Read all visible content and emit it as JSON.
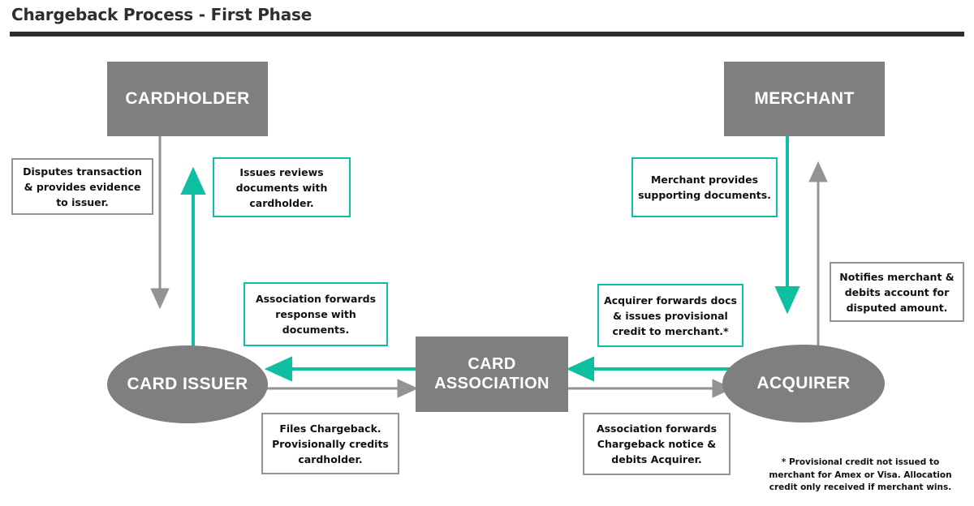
{
  "header": {
    "title": "Chargeback Process - First Phase"
  },
  "colors": {
    "entity_fill": "#7f7f7f",
    "entity_text": "#ffffff",
    "gray_line": "#939393",
    "teal_line": "#0fbfa1",
    "title_text": "#2e2e2e",
    "note_text": "#111111"
  },
  "entities": {
    "cardholder": {
      "label": "CARDHOLDER",
      "shape": "rectangle"
    },
    "merchant": {
      "label": "MERCHANT",
      "shape": "rectangle"
    },
    "card_association": {
      "label": "CARD\nASSOCIATION",
      "line1": "CARD",
      "line2": "ASSOCIATION",
      "shape": "rectangle"
    },
    "card_issuer": {
      "label": "CARD ISSUER",
      "shape": "ellipse"
    },
    "acquirer": {
      "label": "ACQUIRER",
      "shape": "ellipse"
    }
  },
  "notes": {
    "disputes_transaction": {
      "text": "Disputes transaction & provides evidence to issuer.",
      "color": "gray"
    },
    "issues_reviews": {
      "text": "Issues reviews documents with cardholder.",
      "color": "teal"
    },
    "merchant_provides": {
      "text": "Merchant provides supporting documents.",
      "color": "teal"
    },
    "notifies_merchant": {
      "text": "Notifies merchant & debits account for disputed amount.",
      "color": "gray"
    },
    "association_forwards_response": {
      "text": "Association forwards response with documents.",
      "color": "teal"
    },
    "acquirer_forwards_docs": {
      "text": "Acquirer forwards docs & issues provisional credit to merchant.*",
      "color": "teal"
    },
    "files_chargeback": {
      "text": "Files Chargeback. Provisionally credits cardholder.",
      "color": "gray"
    },
    "association_forwards_notice": {
      "text": "Association forwards Chargeback notice & debits Acquirer.",
      "color": "gray"
    }
  },
  "footnote": {
    "text": "* Provisional credit not issued to merchant for Amex or Visa. Allocation credit only received if merchant wins."
  },
  "flows": [
    {
      "from": "cardholder",
      "to": "card_issuer",
      "color": "gray",
      "direction": "down"
    },
    {
      "from": "card_issuer",
      "to": "cardholder",
      "color": "teal",
      "direction": "up"
    },
    {
      "from": "merchant",
      "to": "acquirer",
      "color": "teal",
      "direction": "down"
    },
    {
      "from": "acquirer",
      "to": "merchant",
      "color": "gray",
      "direction": "up"
    },
    {
      "from": "card_association",
      "to": "card_issuer",
      "color": "teal",
      "direction": "left"
    },
    {
      "from": "card_issuer",
      "to": "card_association",
      "color": "gray",
      "direction": "right"
    },
    {
      "from": "acquirer",
      "to": "card_association",
      "color": "teal",
      "direction": "left"
    },
    {
      "from": "card_association",
      "to": "acquirer",
      "color": "gray",
      "direction": "right"
    }
  ]
}
